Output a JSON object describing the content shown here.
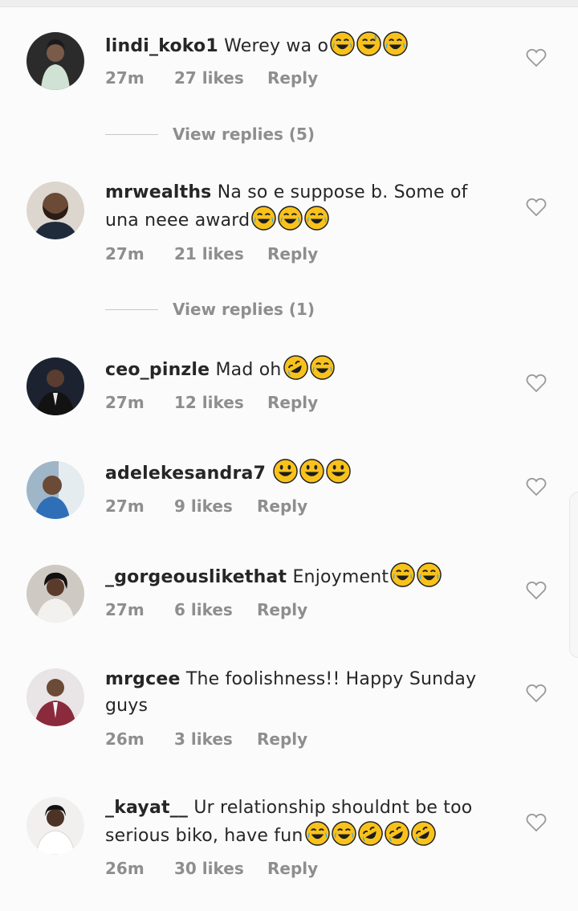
{
  "comments": [
    {
      "username": "lindi_koko1",
      "text": "Werey wa o",
      "time": "27m",
      "likes": "27 likes",
      "reply": "Reply",
      "view_replies": "View replies (5)",
      "emojis": [
        "joy",
        "grin-sweat",
        "joy"
      ]
    },
    {
      "username": "mrwealths",
      "text_line1": "Na so e suppose b.  Some of",
      "text_line2": "una neee award",
      "time": "27m",
      "likes": "21 likes",
      "reply": "Reply",
      "view_replies": "View replies (1)",
      "emojis": [
        "joy",
        "joy",
        "joy"
      ]
    },
    {
      "username": "ceo_pinzle",
      "text": "Mad oh",
      "time": "27m",
      "likes": "12 likes",
      "reply": "Reply",
      "emojis": [
        "rofl",
        "joy"
      ]
    },
    {
      "username": "adelekesandra7",
      "text": "",
      "time": "27m",
      "likes": "9 likes",
      "reply": "Reply",
      "emojis": [
        "grin",
        "grin",
        "grin"
      ]
    },
    {
      "username": "_gorgeouslikethat",
      "text": "Enjoyment",
      "time": "27m",
      "likes": "6 likes",
      "reply": "Reply",
      "emojis": [
        "joy",
        "joy"
      ]
    },
    {
      "username": "mrgcee",
      "text_line1": "The foolishness!! Happy Sunday",
      "text_line2": "guys",
      "time": "26m",
      "likes": "3 likes",
      "reply": "Reply"
    },
    {
      "username": "_kayat__",
      "text_line1": "Ur relationship shouldnt be too",
      "text_line2": "serious biko, have fun",
      "time": "26m",
      "likes": "30 likes",
      "reply": "Reply",
      "emojis": [
        "joy",
        "joy",
        "rofl",
        "rofl",
        "rofl"
      ]
    }
  ],
  "colors": {
    "text": "#262626",
    "meta": "#8e8e8e",
    "emoji": "#f9c21b",
    "background": "#fbfbfc"
  },
  "icons": {
    "like": "heart-outline-icon",
    "emoji_joy": "face-with-tears-of-joy",
    "emoji_rofl": "rolling-on-floor-laughing",
    "emoji_grin": "grinning-face"
  }
}
